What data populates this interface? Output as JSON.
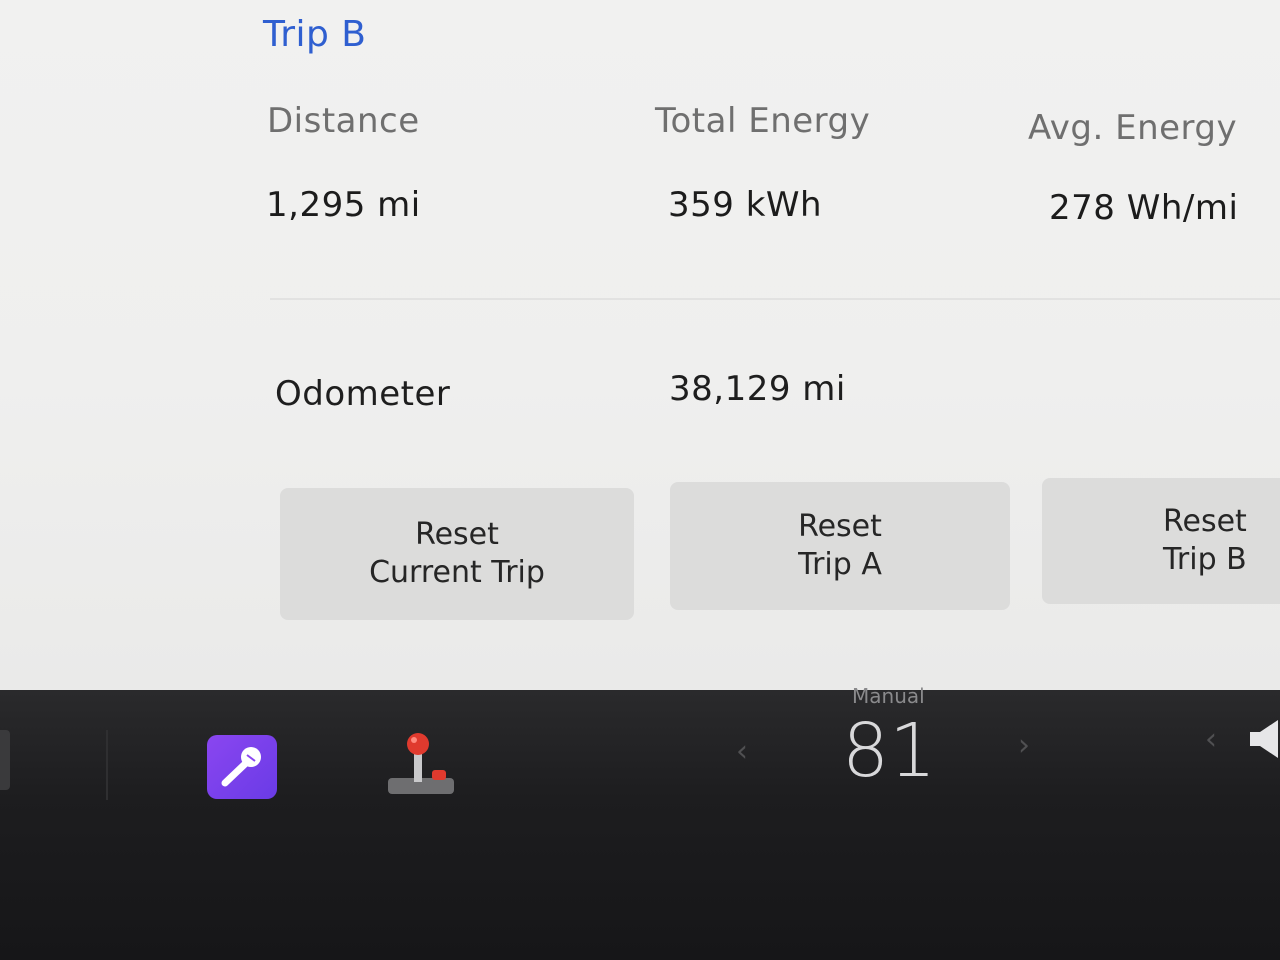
{
  "trip": {
    "title": "Trip B",
    "distance_label": "Distance",
    "distance_value": "1,295  mi",
    "total_energy_label": "Total Energy",
    "total_energy_value": "359  kWh",
    "avg_energy_label": "Avg. Energy",
    "avg_energy_value": "278  Wh/mi"
  },
  "odometer": {
    "label": "Odometer",
    "value": "38,129  mi"
  },
  "buttons": {
    "reset_current": [
      "Reset",
      "Current Trip"
    ],
    "reset_a": [
      "Reset",
      "Trip A"
    ],
    "reset_b": [
      "Reset",
      "Trip B"
    ]
  },
  "taskbar": {
    "apps": [
      {
        "icon": "karaoke-microphone-icon",
        "color": "#7a42ea"
      },
      {
        "icon": "joystick-icon",
        "color": "#e03a2e"
      }
    ],
    "climate": {
      "mode": "Manual",
      "temperature": "81"
    },
    "volume_icon": "speaker-icon"
  },
  "colors": {
    "accent": "#2f5fd0",
    "background": "#f1f1f0",
    "taskbar": "#1d1d1f"
  }
}
